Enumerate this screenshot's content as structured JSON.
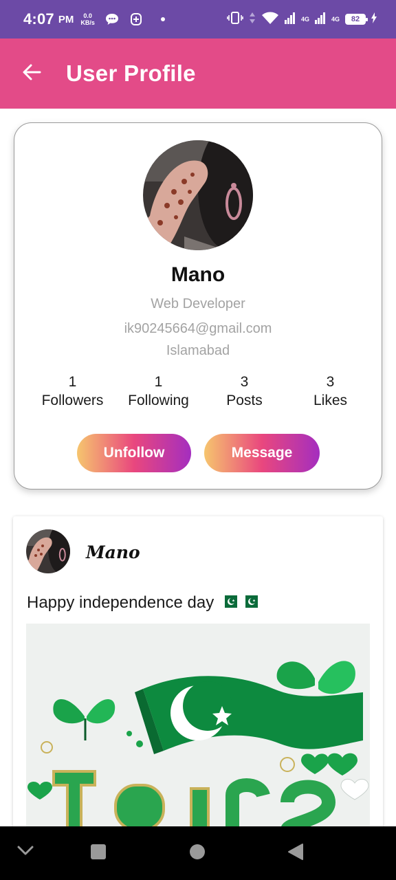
{
  "status_bar": {
    "time": "4:07",
    "ampm": "PM",
    "speed_value": "0.0",
    "speed_unit": "KB/s",
    "network_1": "4G",
    "network_2": "4G",
    "battery": "82"
  },
  "app_bar": {
    "title": "User Profile",
    "back_icon": "arrow-left-icon"
  },
  "profile": {
    "name": "Mano",
    "role": "Web Developer",
    "email": "ik90245664@gmail.com",
    "city": "Islamabad",
    "stats": [
      {
        "count": "1",
        "label": "Followers"
      },
      {
        "count": "1",
        "label": "Following"
      },
      {
        "count": "3",
        "label": "Posts"
      },
      {
        "count": "3",
        "label": "Likes"
      }
    ],
    "unfollow_label": "Unfollow",
    "message_label": "Message"
  },
  "post": {
    "author": "Mano",
    "text": "Happy independence day"
  },
  "colors": {
    "status_bar": "#6c4aa6",
    "app_bar": "#e34b88",
    "gradient_start": "#f6c56e",
    "gradient_mid": "#e9477e",
    "gradient_end": "#a42ebf",
    "flag_green": "#0b6b3a"
  }
}
